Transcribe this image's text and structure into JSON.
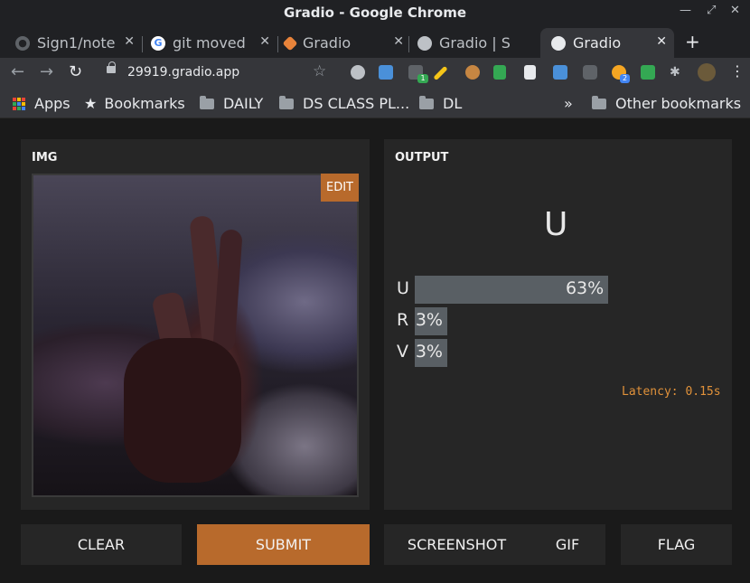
{
  "window": {
    "title": "Gradio - Google Chrome"
  },
  "tabs": [
    {
      "label": "Sign1/note",
      "icon": "github-icon"
    },
    {
      "label": "git moved",
      "icon": "google-icon"
    },
    {
      "label": "Gradio",
      "icon": "gradio-icon"
    },
    {
      "label": "Gradio | S",
      "icon": "globe-icon"
    },
    {
      "label": "Gradio",
      "icon": "globe-icon",
      "active": true
    }
  ],
  "toolbar": {
    "url": "29919.gradio.app",
    "ext_badges": [
      "1",
      "2"
    ]
  },
  "bookmarks": {
    "apps": "Apps",
    "bookmarks": "Bookmarks",
    "daily": "DAILY",
    "ds_class": "DS CLASS PL...",
    "dl": "DL",
    "overflow": "»",
    "other": "Other bookmarks"
  },
  "input_panel": {
    "label": "IMG",
    "edit_label": "EDIT"
  },
  "output_panel": {
    "label": "OUTPUT",
    "predicted": "U",
    "confidences": [
      {
        "label": "U",
        "value": 0.63,
        "text": "63%"
      },
      {
        "label": "R",
        "value": 0.03,
        "text": "3%"
      },
      {
        "label": "V",
        "value": 0.03,
        "text": "3%"
      }
    ],
    "latency": "Latency: 0.15s"
  },
  "buttons": {
    "clear": "CLEAR",
    "submit": "SUBMIT",
    "screenshot": "SCREENSHOT",
    "gif": "GIF",
    "flag": "FLAG"
  },
  "colors": {
    "accent": "#b86a2c",
    "bar": "#595f64",
    "latency": "#e0913a",
    "panel": "#262626"
  }
}
